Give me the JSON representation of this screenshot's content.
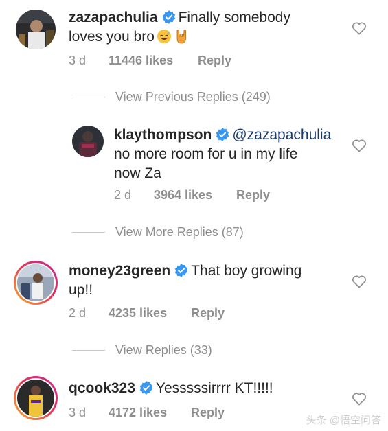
{
  "comments": [
    {
      "username": "zazapachulia",
      "text_line1": "Finally somebody",
      "text_line2": "loves you bro",
      "emojis": [
        "grinning-sweat-emoji",
        "rock-on-hand-emoji"
      ],
      "time": "3 d",
      "likes": "11446 likes",
      "reply": "Reply"
    },
    {
      "username": "klaythompson",
      "mention": "@zazapachulia",
      "text_line2": "no more room for u in my life",
      "text_line3": "now Za",
      "time": "2 d",
      "likes": "3964 likes",
      "reply": "Reply"
    },
    {
      "username": "money23green",
      "text_line1": "That boy growing",
      "text_line2": "up!!",
      "time": "2 d",
      "likes": "4235 likes",
      "reply": "Reply"
    },
    {
      "username": "qcook323",
      "text_line1": "Yesssssirrrr KT!!!!!",
      "time": "3 d",
      "likes": "4172 likes",
      "reply": "Reply"
    }
  ],
  "view_replies": [
    "View Previous Replies (249)",
    "View More Replies (87)",
    "View Replies (33)"
  ],
  "watermark": "头条 @悟空问答",
  "colors": {
    "verified_blue": "#3897f0",
    "meta_gray": "#8e8e8e",
    "mention": "#1b3a6b"
  }
}
